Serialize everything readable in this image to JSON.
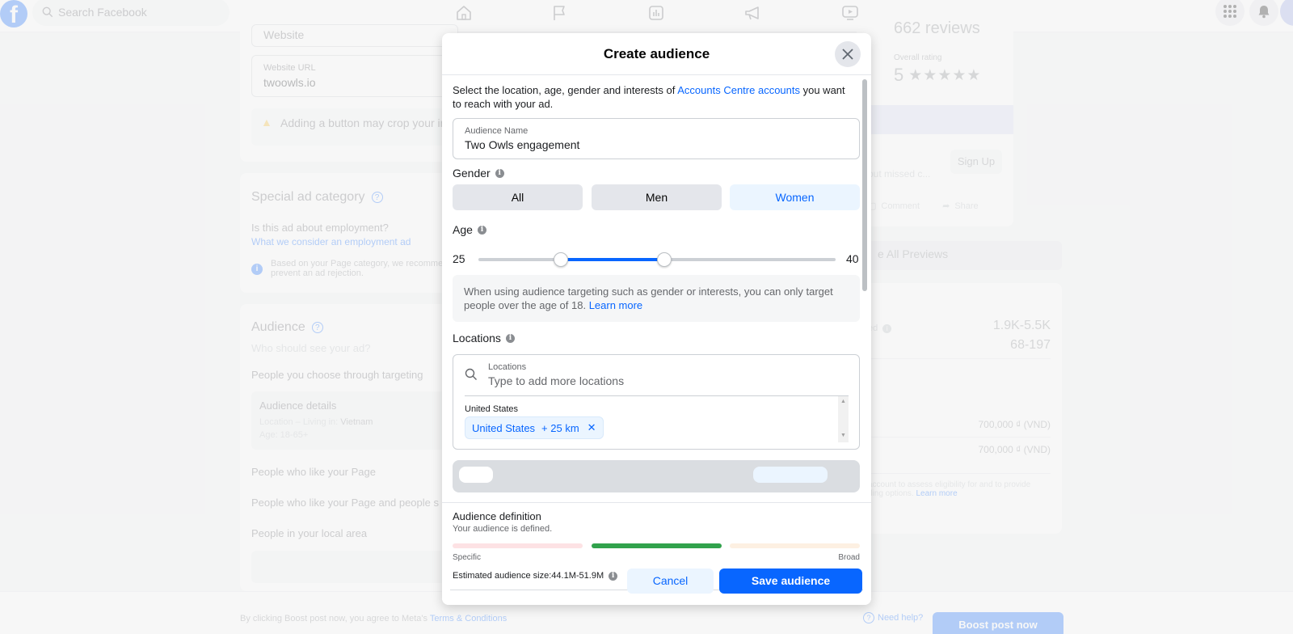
{
  "topbar": {
    "search_placeholder": "Search Facebook",
    "nav_icons": [
      "home-icon",
      "flag-icon",
      "insights-icon",
      "megaphone-icon",
      "video-icon"
    ],
    "right_icons": [
      "menu-grid-icon",
      "bell-icon",
      "profile-avatar"
    ]
  },
  "background": {
    "website_label": "Website",
    "website_url_label": "Website URL",
    "website_url_value": "twoowls.io",
    "warning_text": "Adding a button may crop your im",
    "special_ad": {
      "title": "Special ad category",
      "question": "Is this ad about employment?",
      "link": "What we consider an employment ad",
      "info": "Based on your Page category, we recomme",
      "info_line2": "prevent an ad rejection."
    },
    "audience": {
      "title": "Audience",
      "subtitle": "Who should see your ad?",
      "option_targeting": "People you choose through targeting",
      "details_title": "Audience details",
      "details_location_prefix": "Location – Living in: ",
      "details_location_value": "Vietnam",
      "details_age": "Age: 18-65+",
      "option_page_likes": "People who like your Page",
      "option_page_likes_friends": "People who like your Page and people s",
      "option_local": "People in your local area"
    },
    "preview": {
      "reviews": "662 reviews",
      "overall_rating_label": "Overall rating",
      "rating": "5",
      "stars": "★★★★★",
      "missed_text": "but missed c...",
      "sign_up": "Sign Up",
      "comment": "Comment",
      "share": "Share",
      "see_all_previews": "e All Previews"
    },
    "estimates": {
      "label": "ed",
      "reach": "1.9K-5.5K",
      "engagement": "68-197",
      "budget_1": "700,000 ₫ (VND)",
      "budget_2": "700,000 ₫ (VND)",
      "note_line1": "account to assess eligibility for and to provide",
      "note_line2_prefix": "ding options. ",
      "note_link": "Learn more"
    },
    "footer": {
      "terms_prefix": "By clicking Boost post now, you agree to Meta's ",
      "terms_link": "Terms & Conditions",
      "need_help": "Need help?",
      "boost_button": "Boost post now"
    }
  },
  "modal": {
    "title": "Create audience",
    "intro_prefix": "Select the location, age, gender and interests of ",
    "intro_link": "Accounts Centre accounts",
    "intro_suffix": " you want to reach with your ad.",
    "audience_name_label": "Audience Name",
    "audience_name_value": "Two Owls engagement",
    "gender_label": "Gender",
    "gender_options": [
      "All",
      "Men",
      "Women"
    ],
    "gender_selected": "Women",
    "age_label": "Age",
    "age_min": "25",
    "age_max": "40",
    "age_range_bounds": [
      13,
      65
    ],
    "age_notice": "When using audience targeting such as gender or interests, you can only target people over the age of 18. ",
    "age_notice_link": "Learn more",
    "locations_label": "Locations",
    "locations_field_label": "Locations",
    "locations_placeholder": "Type to add more locations",
    "location_group": "United States",
    "location_chip": {
      "name": "United States",
      "radius": "+ 25 km"
    },
    "definition_title": "Audience definition",
    "definition_subtitle": "Your audience is defined.",
    "meter_left_label": "Specific",
    "meter_right_label": "Broad",
    "meter_state": "defined",
    "meter_colors": {
      "specific": "#fde2e4",
      "defined": "#31a24c",
      "broad": "#fdf0e2"
    },
    "estimated_size_label": "Estimated audience size: ",
    "estimated_size_value": "44.1M-51.9M",
    "cancel_button": "Cancel",
    "save_button": "Save audience"
  },
  "colors": {
    "accent": "#0866ff",
    "selected_bg": "#ebf5ff"
  }
}
